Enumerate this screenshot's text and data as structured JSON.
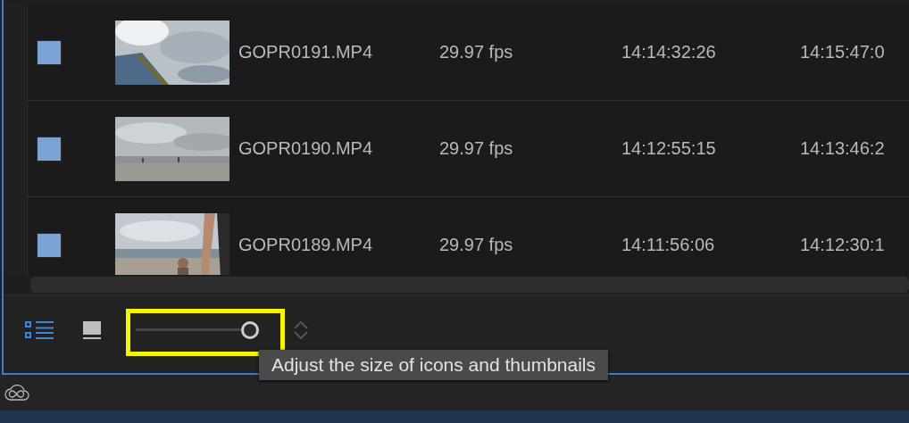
{
  "clips": [
    {
      "color": "#7ba3d6",
      "column_1": "GOPR0191.MP4",
      "column_2": "29.97 fps",
      "column_3": "14:14:32:26",
      "column_4": "14:15:47:0"
    },
    {
      "color": "#7ba3d6",
      "column_1": "GOPR0190.MP4",
      "column_2": "29.97 fps",
      "column_3": "14:12:55:15",
      "column_4": "14:13:46:2"
    },
    {
      "color": "#7ba3d6",
      "column_1": "GOPR0189.MP4",
      "column_2": "29.97 fps",
      "column_3": "14:11:56:06",
      "column_4": "14:12:30:1"
    }
  ],
  "toolbar": {
    "list_view": {
      "selected": true
    },
    "icon_view": {
      "selected": false
    },
    "zoom_slider": {
      "level": 1,
      "highlighted": true
    },
    "tooltip": "Adjust the size of icons and thumbnails"
  }
}
